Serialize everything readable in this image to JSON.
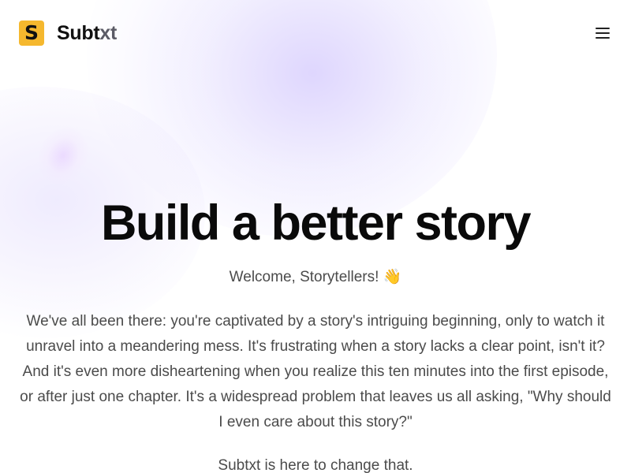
{
  "header": {
    "logo_glyph": "S",
    "brand_part1": "Subt",
    "brand_part2": "xt",
    "menu_icon": "hamburger-menu-icon"
  },
  "hero": {
    "title": "Build a better story",
    "welcome": "Welcome, Storytellers! 👋",
    "paragraph": "We've all been there: you're captivated by a story's intriguing beginning, only to watch it unravel into a meandering mess. It's frustrating when a story lacks a clear point, isn't it? And it's even more disheartening when you realize this ten minutes into the first episode, or after just one chapter. It's a widespread problem that leaves us all asking, \"Why should I even care about this story?\"",
    "tagline": "Subtxt is here to change that."
  },
  "colors": {
    "logo_bg": "#f5b82e",
    "brand_dark": "#111111",
    "brand_muted": "#5b5b66",
    "body_text": "#4b4b4b",
    "glow": "#c4b5fd"
  }
}
